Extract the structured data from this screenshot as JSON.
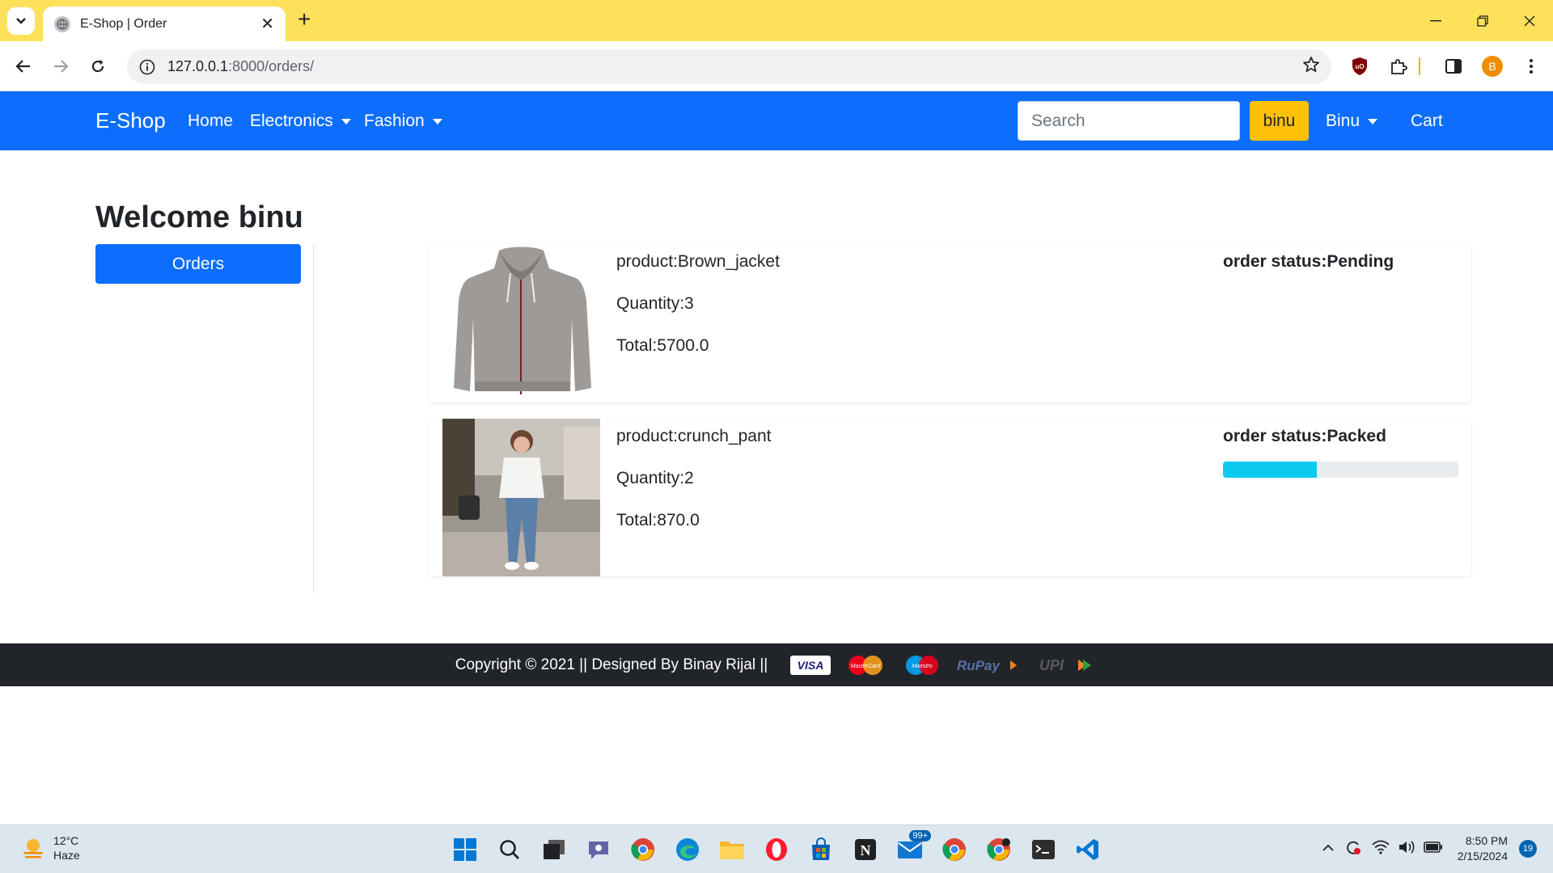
{
  "browser": {
    "tab_title": "E-Shop | Order",
    "new_tab": "+",
    "url_host": "127.0.0.1",
    "url_rest": ":8000/orders/",
    "profile_initial": "B"
  },
  "navbar": {
    "brand": "E-Shop",
    "links": [
      "Home",
      "Electronics",
      "Fashion"
    ],
    "search_placeholder": "Search",
    "search_button": "binu",
    "user_menu": "Binu",
    "cart": "Cart",
    "color": "#0d6efd"
  },
  "main": {
    "welcome": "Welcome binu",
    "orders_button": "Orders"
  },
  "orders": [
    {
      "product": "product:Brown_jacket",
      "quantity": "Quantity:3",
      "total": "Total:5700.0",
      "status": "order status:Pending"
    },
    {
      "product": "product:crunch_pant",
      "quantity": "Quantity:2",
      "total": "Total:870.0",
      "status": "order status:Packed",
      "progress": 0.4
    }
  ],
  "footer": {
    "text": "Copyright © 2021 || Designed By Binay Rijal ||",
    "payments": [
      "VISA",
      "MasterCard",
      "Maestro",
      "RuPay",
      "UPI"
    ]
  },
  "taskbar": {
    "temperature": "12°C",
    "weather": "Haze",
    "mail_badge": "99+",
    "time": "8:50 PM",
    "date": "2/15/2024",
    "notifications": "19"
  }
}
